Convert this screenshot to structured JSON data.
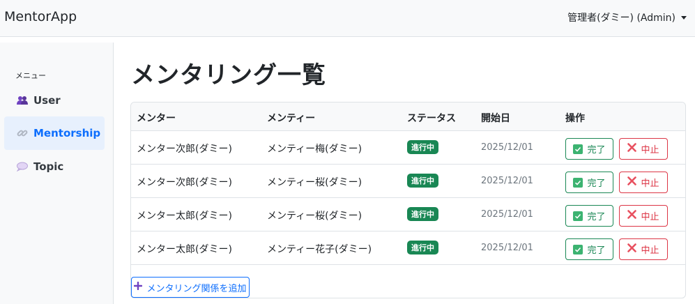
{
  "app": {
    "brand": "MentorApp",
    "user_menu": "管理者(ダミー) (Admin)"
  },
  "sidebar": {
    "heading": "メニュー",
    "items": [
      {
        "label": "User",
        "icon": "users-icon",
        "active": false
      },
      {
        "label": "Mentorship",
        "icon": "link-icon",
        "active": true
      },
      {
        "label": "Topic",
        "icon": "speech-bubble-icon",
        "active": false
      }
    ]
  },
  "main": {
    "title": "メンタリング一覧",
    "table": {
      "headers": [
        "メンター",
        "メンティー",
        "ステータス",
        "開始日",
        "操作"
      ],
      "rows": [
        {
          "mentor": "メンター次郎(ダミー)",
          "mentee": "メンティー梅(ダミー)",
          "status": "進行中",
          "start": "2025/12/01",
          "done": "完了",
          "stop": "中止"
        },
        {
          "mentor": "メンター次郎(ダミー)",
          "mentee": "メンティー桜(ダミー)",
          "status": "進行中",
          "start": "2025/12/01",
          "done": "完了",
          "stop": "中止"
        },
        {
          "mentor": "メンター太郎(ダミー)",
          "mentee": "メンティー桜(ダミー)",
          "status": "進行中",
          "start": "2025/12/01",
          "done": "完了",
          "stop": "中止"
        },
        {
          "mentor": "メンター太郎(ダミー)",
          "mentee": "メンティー花子(ダミー)",
          "status": "進行中",
          "start": "2025/12/01",
          "done": "完了",
          "stop": "中止"
        }
      ]
    },
    "add_button": "メンタリング関係を追加"
  },
  "colors": {
    "primary": "#0d6efd",
    "success": "#198754",
    "danger": "#dc3545"
  }
}
